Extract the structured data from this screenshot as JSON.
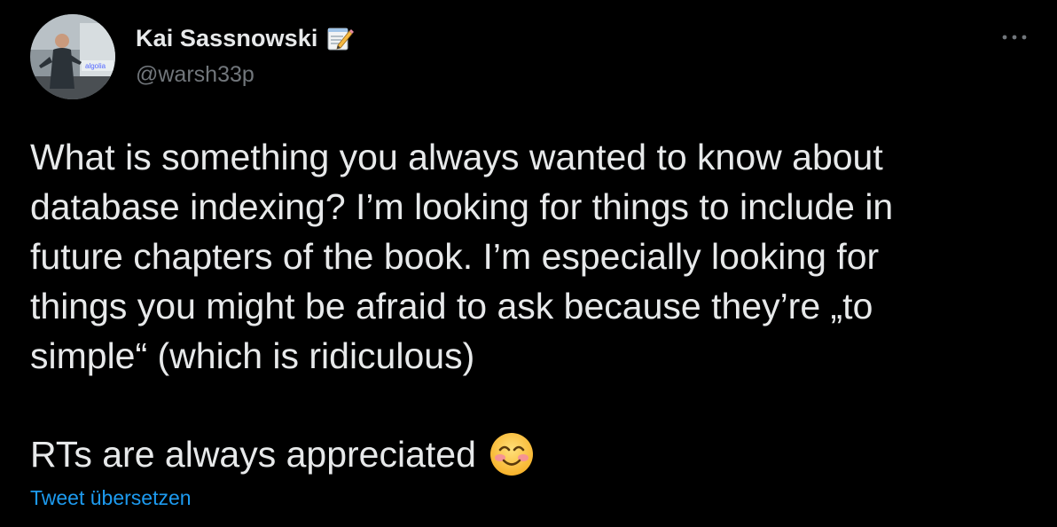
{
  "author": {
    "display_name": "Kai Sassnowski",
    "handle": "@warsh33p",
    "name_icon": "memo-icon",
    "avatar_icon": "avatar-photo"
  },
  "tweet": {
    "text": "What is something you always wanted to know about\ndatabase indexing? I’m looking for things to include in\nfuture chapters of the book. I’m especially looking for\nthings you might be afraid to ask because they’re „to\nsimple“ (which is ridiculous)",
    "closing_line": "RTs are always appreciated",
    "closing_icon": "smiling-face-icon",
    "translate_label": "Tweet übersetzen",
    "avatar_banner_text": "algolia"
  },
  "menu": {
    "more_icon": "more-dots-icon"
  },
  "colors": {
    "background": "#000000",
    "text_primary": "#e7e9ea",
    "text_secondary": "#71767b",
    "link": "#1d9bf0"
  }
}
